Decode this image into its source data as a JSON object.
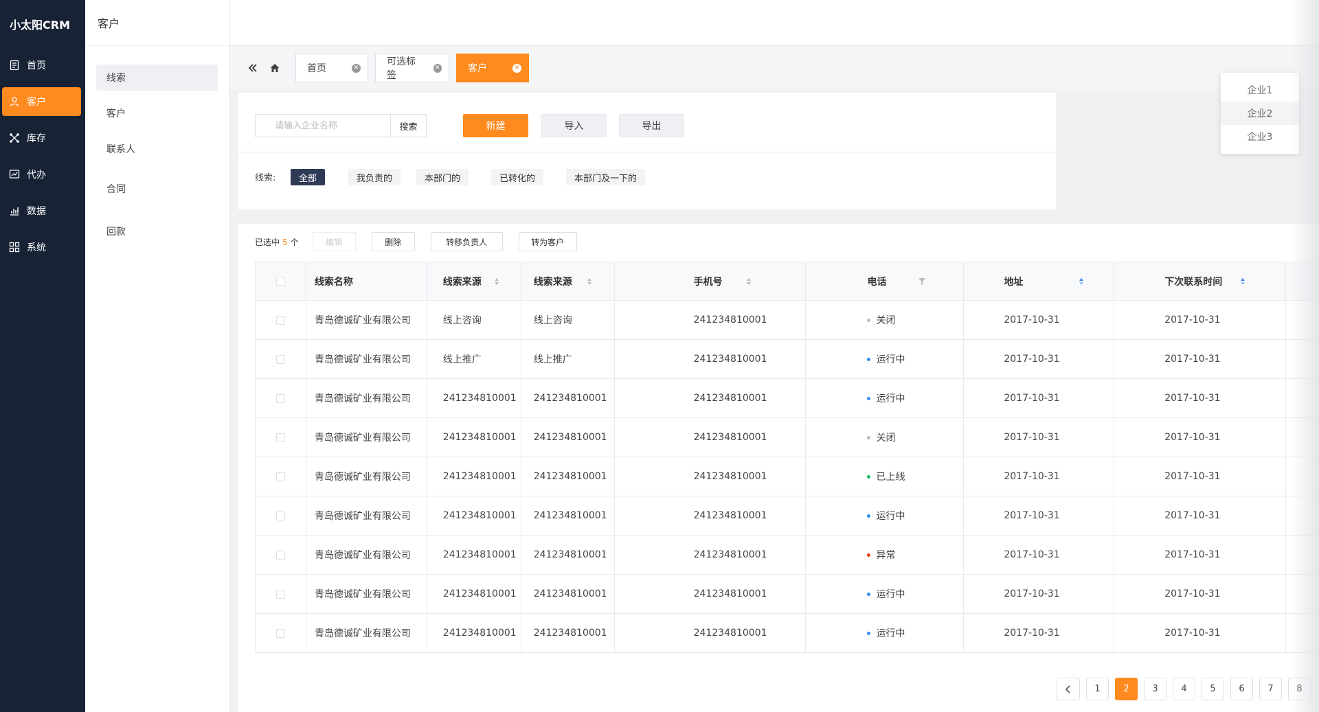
{
  "app": {
    "logo": "小太阳CRM"
  },
  "nav": [
    {
      "label": "首页",
      "icon": "document-icon",
      "active": false
    },
    {
      "label": "客户",
      "icon": "user-icon",
      "active": true
    },
    {
      "label": "库存",
      "icon": "network-icon",
      "active": false
    },
    {
      "label": "代办",
      "icon": "chart-board-icon",
      "active": false
    },
    {
      "label": "数据",
      "icon": "bar-chart-icon",
      "active": false
    },
    {
      "label": "系统",
      "icon": "grid-icon",
      "active": false
    }
  ],
  "submenu": {
    "title": "客户",
    "items": [
      {
        "label": "线索",
        "active": true
      },
      {
        "label": "客户",
        "active": false
      },
      {
        "label": "联系人",
        "active": false
      },
      {
        "label": "合同",
        "active": false
      },
      {
        "label": "回款",
        "active": false
      }
    ]
  },
  "tabs": [
    {
      "label": "首页",
      "active": false
    },
    {
      "label": "可选标签",
      "active": false
    },
    {
      "label": "客户",
      "active": true
    }
  ],
  "filter": {
    "search_placeholder": "请输入企业名称",
    "search_button": "搜索",
    "new_button": "新建",
    "import_button": "导入",
    "export_button": "导出",
    "label": "线索:",
    "chips": [
      {
        "label": "全部",
        "active": true
      },
      {
        "label": "我负责的",
        "active": false
      },
      {
        "label": "本部门的",
        "active": false
      },
      {
        "label": "已转化的",
        "active": false
      },
      {
        "label": "本部门及一下的",
        "active": false
      }
    ]
  },
  "dropdown": {
    "items": [
      {
        "label": "企业1",
        "hover": false
      },
      {
        "label": "企业2",
        "hover": true
      },
      {
        "label": "企业3",
        "hover": false
      }
    ]
  },
  "toolbar": {
    "selected_prefix": "已选中",
    "selected_count": "5",
    "selected_suffix": "个",
    "edit": "编辑",
    "delete": "删除",
    "transfer": "转移负责人",
    "convert": "转为客户"
  },
  "table": {
    "columns": [
      "线索名称",
      "线索来源",
      "线索来源",
      "手机号",
      "电话",
      "地址",
      "下次联系时间"
    ],
    "rows": [
      {
        "name": "青岛德诚矿业有限公司",
        "src1": "线上咨询",
        "src2": "线上咨询",
        "mobile": "241234810001",
        "status": "关闭",
        "status_color": "#bbbbbb",
        "address": "2017-10-31",
        "next": "2017-10-31"
      },
      {
        "name": "青岛德诚矿业有限公司",
        "src1": "线上推广",
        "src2": "线上推广",
        "mobile": "241234810001",
        "status": "运行中",
        "status_color": "#2d8cf0",
        "address": "2017-10-31",
        "next": "2017-10-31"
      },
      {
        "name": "青岛德诚矿业有限公司",
        "src1": "241234810001",
        "src2": "241234810001",
        "mobile": "241234810001",
        "status": "运行中",
        "status_color": "#2d8cf0",
        "address": "2017-10-31",
        "next": "2017-10-31"
      },
      {
        "name": "青岛德诚矿业有限公司",
        "src1": "241234810001",
        "src2": "241234810001",
        "mobile": "241234810001",
        "status": "关闭",
        "status_color": "#bbbbbb",
        "address": "2017-10-31",
        "next": "2017-10-31"
      },
      {
        "name": "青岛德诚矿业有限公司",
        "src1": "241234810001",
        "src2": "241234810001",
        "mobile": "241234810001",
        "status": "已上线",
        "status_color": "#19be6b",
        "address": "2017-10-31",
        "next": "2017-10-31"
      },
      {
        "name": "青岛德诚矿业有限公司",
        "src1": "241234810001",
        "src2": "241234810001",
        "mobile": "241234810001",
        "status": "运行中",
        "status_color": "#2d8cf0",
        "address": "2017-10-31",
        "next": "2017-10-31"
      },
      {
        "name": "青岛德诚矿业有限公司",
        "src1": "241234810001",
        "src2": "241234810001",
        "mobile": "241234810001",
        "status": "异常",
        "status_color": "#ed3f14",
        "address": "2017-10-31",
        "next": "2017-10-31"
      },
      {
        "name": "青岛德诚矿业有限公司",
        "src1": "241234810001",
        "src2": "241234810001",
        "mobile": "241234810001",
        "status": "运行中",
        "status_color": "#2d8cf0",
        "address": "2017-10-31",
        "next": "2017-10-31"
      },
      {
        "name": "青岛德诚矿业有限公司",
        "src1": "241234810001",
        "src2": "241234810001",
        "mobile": "241234810001",
        "status": "运行中",
        "status_color": "#2d8cf0",
        "address": "2017-10-31",
        "next": "2017-10-31"
      }
    ]
  },
  "pagination": {
    "pages": [
      "1",
      "2",
      "3",
      "4",
      "5",
      "6",
      "7",
      "8"
    ],
    "current": "2"
  },
  "colors": {
    "accent": "#ff8a1f",
    "sidebar": "#172235",
    "chip_active": "#2f3a56"
  }
}
